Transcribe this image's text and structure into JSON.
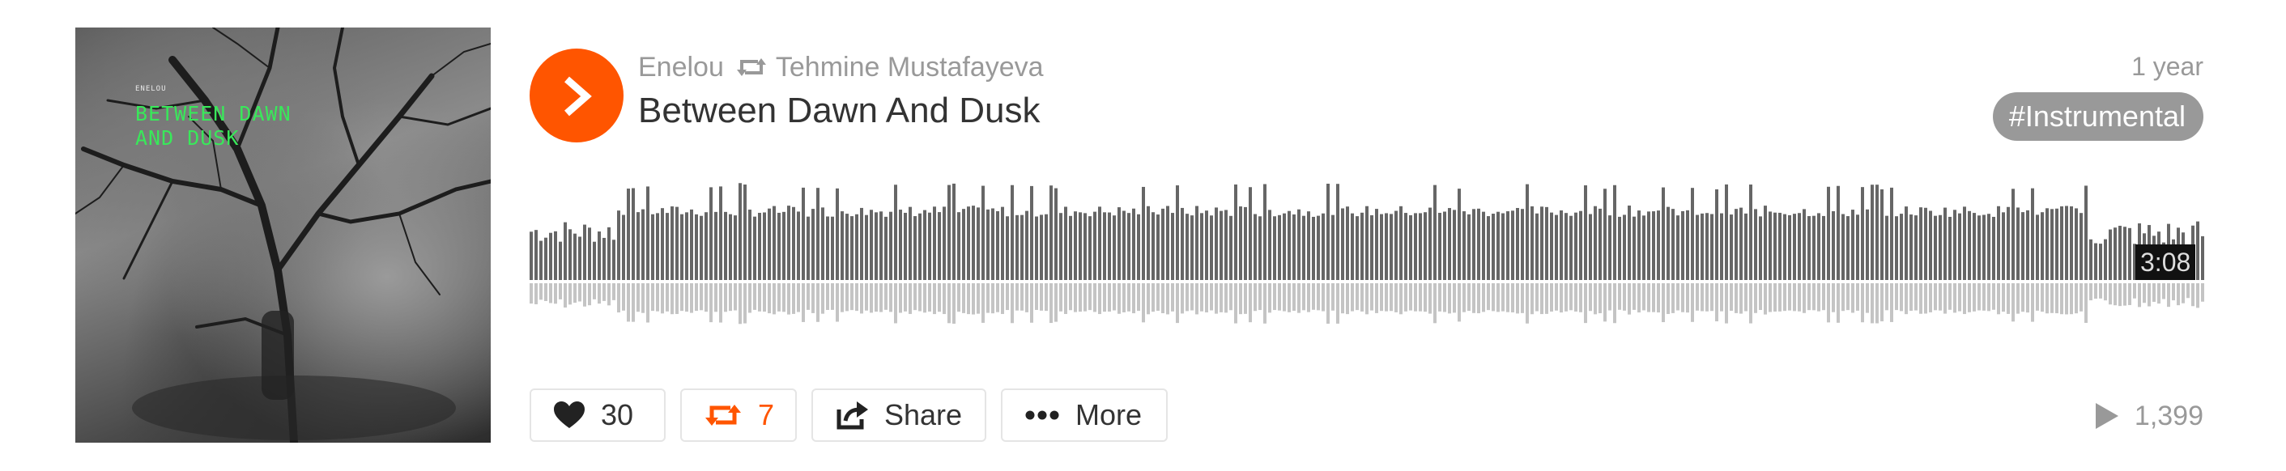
{
  "artwork": {
    "artist_text": "ENELOU",
    "title_text": "BETWEEN DAWN AND DUSK"
  },
  "track": {
    "uploader": "Enelou",
    "reposter": "Tehmine Mustafayeva",
    "title": "Between Dawn And Dusk",
    "time_ago": "1 year",
    "tag": "Instrumental",
    "duration": "3:08"
  },
  "actions": {
    "like_count": "30",
    "repost_count": "7",
    "share_label": "Share",
    "more_label": "More"
  },
  "stats": {
    "play_count": "1,399"
  },
  "colors": {
    "accent": "#ff5500",
    "muted_text": "#999999",
    "title_text": "#333333",
    "waveform_top": "#666666",
    "waveform_bottom": "#c4c4c4"
  }
}
